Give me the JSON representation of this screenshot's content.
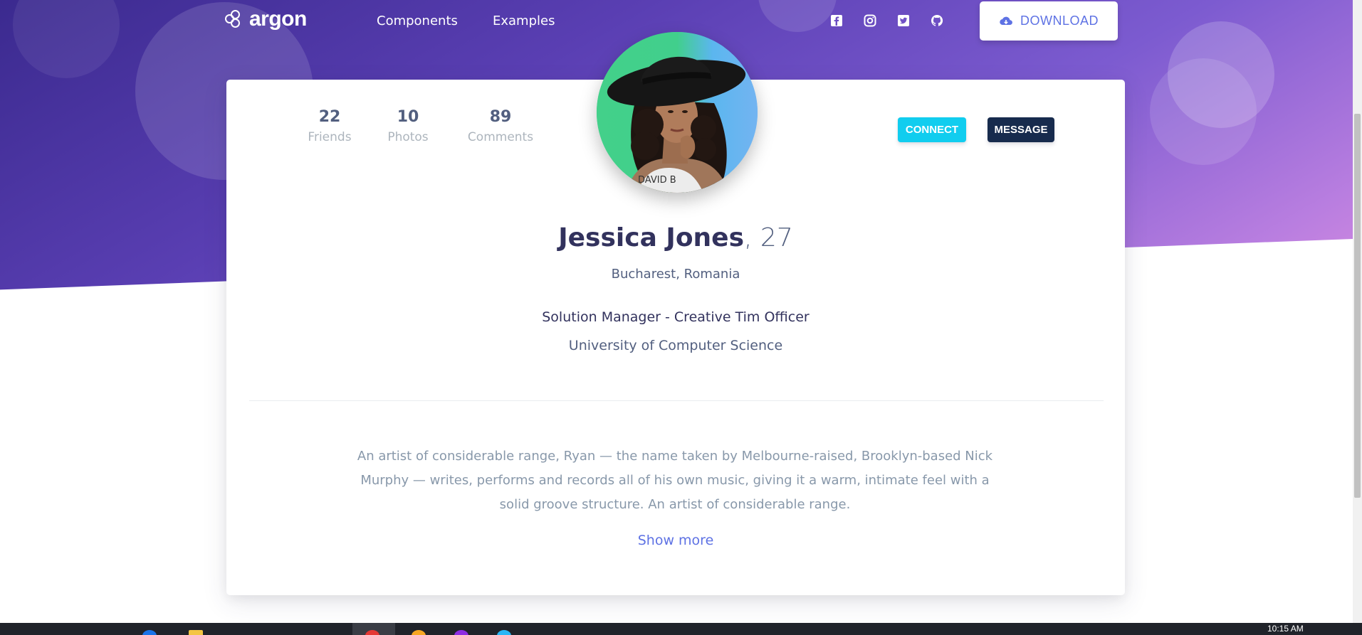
{
  "navbar": {
    "brand": "argon",
    "links": [
      "Components",
      "Examples"
    ],
    "social": [
      "facebook-square-icon",
      "instagram-icon",
      "twitter-square-icon",
      "github-icon"
    ],
    "download_label": "DOWNLOAD"
  },
  "profile": {
    "stats": [
      {
        "value": "22",
        "label": "Friends"
      },
      {
        "value": "10",
        "label": "Photos"
      },
      {
        "value": "89",
        "label": "Comments"
      }
    ],
    "connect_label": "CONNECT",
    "message_label": "MESSAGE",
    "name": "Jessica Jones",
    "age": ", 27",
    "location": "Bucharest, Romania",
    "job": "Solution Manager - Creative Tim Officer",
    "school": "University of Computer Science",
    "bio": "An artist of considerable range, Ryan — the name taken by Melbourne-raised, Brooklyn-based Nick Murphy — writes, performs and records all of his own music, giving it a warm, intimate feel with a solid groove structure. An artist of considerable range.",
    "show_more": "Show more",
    "shirt_text": "DAVID B"
  },
  "taskbar": {
    "clock": "10:15 AM"
  },
  "colors": {
    "primary": "#5e72e4",
    "info": "#11cdef",
    "default": "#172b4d",
    "gradient_start": "#3b2a8f",
    "gradient_end": "#d38ae0"
  }
}
